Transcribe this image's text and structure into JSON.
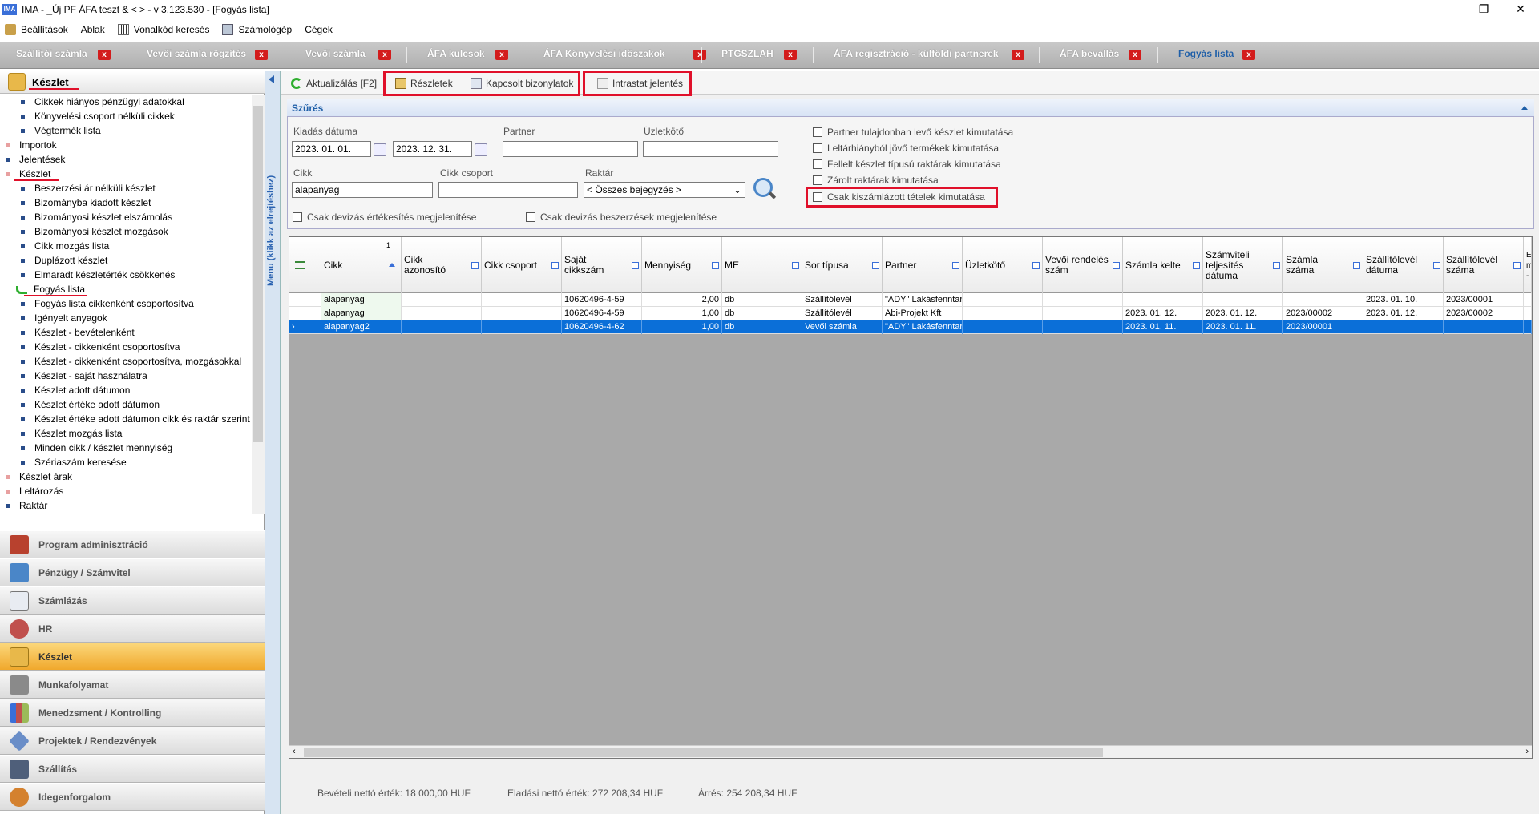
{
  "window": {
    "title": "IMA - _Új PF ÁFA teszt & < > - v 3.123.530 - [Fogyás lista]",
    "app_icon_text": "IMA",
    "controls": [
      "—",
      "❐",
      "✕"
    ]
  },
  "menubar": {
    "items": [
      "Beállítások",
      "Ablak",
      "Vonalkód keresés",
      "Számológép",
      "Cégek"
    ]
  },
  "tabs": [
    {
      "label": "Szállítói számla"
    },
    {
      "label": "Vevői számla rögzítés"
    },
    {
      "label": "Vevői számla"
    },
    {
      "label": "ÁFA kulcsok"
    },
    {
      "label": "ÁFA Könyvelési időszakok"
    },
    {
      "label": "PTGSZLAH"
    },
    {
      "label": "ÁFA regisztráció - külföldi partnerek"
    },
    {
      "label": "ÁFA bevallás"
    },
    {
      "label": "Fogyás lista"
    }
  ],
  "tab_close": "x",
  "left_panel": {
    "header": "Készlet",
    "vertical_label": "Menu (klikk az elrejtéshez)",
    "tree": [
      "Cikkek hiányos pénzügyi adatokkal",
      "Könyvelési csoport nélküli cikkek",
      "Végtermék lista",
      "Importok",
      "Jelentések",
      "Készlet",
      "Beszerzési ár nélküli készlet",
      "Bizományba kiadott készlet",
      "Bizományosi készlet elszámolás",
      "Bizományosi készlet mozgások",
      "Cikk mozgás lista",
      "Duplázott készlet",
      "Elmaradt készletérték csökkenés",
      "Fogyás lista",
      "Fogyás lista cikkenként csoportosítva",
      "Igényelt anyagok",
      "Készlet - bevételenként",
      "Készlet - cikkenként csoportosítva",
      "Készlet - cikkenként csoportosítva, mozgásokkal",
      "Készlet - saját használatra",
      "Készlet adott dátumon",
      "Készlet értéke adott dátumon",
      "Készlet értéke adott dátumon cikk és raktár szerint",
      "Készlet mozgás lista",
      "Minden cikk / készlet mennyiség",
      "Szériaszám keresése",
      "Készlet árak",
      "Leltározás",
      "Raktár"
    ],
    "categories": [
      "Program adminisztráció",
      "Pénzügy / Számvitel",
      "Számlázás",
      "HR",
      "Készlet",
      "Munkafolyamat",
      "Menedzsment / Kontrolling",
      "Projektek / Rendezvények",
      "Szállítás",
      "Idegenforgalom"
    ]
  },
  "toolbar": {
    "refresh": "Aktualizálás [F2]",
    "details": "Részletek",
    "related_docs": "Kapcsolt bizonylatok",
    "intrastat": "Intrastat jelentés"
  },
  "filter": {
    "title": "Szűrés",
    "issue_date_label": "Kiadás dátuma",
    "date_from": "2023. 01. 01.",
    "date_to": "2023. 12. 31.",
    "partner_label": "Partner",
    "partner_value": "",
    "agent_label": "Üzletkötő",
    "agent_value": "",
    "item_label": "Cikk",
    "item_value": "alapanyag",
    "item_group_label": "Cikk csoport",
    "item_group_value": "",
    "warehouse_label": "Raktár",
    "warehouse_value": "< Összes bejegyzés >",
    "chk_fx_sales": "Csak devizás értékesítés megjelenítése",
    "chk_fx_purchases": "Csak devizás beszerzések megjelenítése",
    "chk_partner_owned": "Partner tulajdonban levő készlet kimutatása",
    "chk_inventory_shortage": "Leltárhiányból jövő termékek kimutatása",
    "chk_unlimited": "Fellelt készlet típusú raktárak kimutatása",
    "chk_locked": "Zárolt raktárak kimutatása",
    "chk_invoiced_only": "Csak kiszámlázott tételek kimutatása"
  },
  "grid": {
    "sort_indicator": "1",
    "columns": [
      "Cikk",
      "Cikk azonosító",
      "Cikk csoport",
      "Saját cikkszám",
      "Mennyiség",
      "ME",
      "Sor típusa",
      "Partner",
      "Üzletkötő",
      "Vevői rendelés szám",
      "Számla kelte",
      "Számviteli teljesítés dátuma",
      "Számla száma",
      "Szállítólevél dátuma",
      "Szállítólevél száma",
      "E m -"
    ],
    "rows": [
      [
        "alapanyag",
        "",
        "",
        "10620496-4-59",
        "2,00",
        "db",
        "Szállítólevél",
        "\"ADY\" Lakásfenntar",
        "",
        "",
        "",
        "",
        "",
        "2023. 01. 10.",
        "2023/00001",
        ""
      ],
      [
        "alapanyag",
        "",
        "",
        "10620496-4-59",
        "1,00",
        "db",
        "Szállítólevél",
        "Abi-Projekt Kft",
        "",
        "",
        "2023. 01. 12.",
        "2023. 01. 12.",
        "2023/00002",
        "2023. 01. 12.",
        "2023/00002",
        ""
      ],
      [
        "alapanyag2",
        "",
        "",
        "10620496-4-62",
        "1,00",
        "db",
        "Vevői számla",
        "\"ADY\" Lakásfenntar",
        "",
        "",
        "2023. 01. 11.",
        "2023. 01. 11.",
        "2023/00001",
        "",
        "",
        ""
      ]
    ],
    "selected_row": 2
  },
  "footer": {
    "income_net": "Bevételi nettó érték: 18 000,00 HUF",
    "sales_net": "Eladási nettó érték: 272 208,34 HUF",
    "margin": "Árrés: 254 208,34 HUF"
  },
  "colors": {
    "accent": "#1f5fa8",
    "selection": "#0b6fd8",
    "highlight_box": "#e0102a",
    "selected_category": "#f0a82c"
  }
}
